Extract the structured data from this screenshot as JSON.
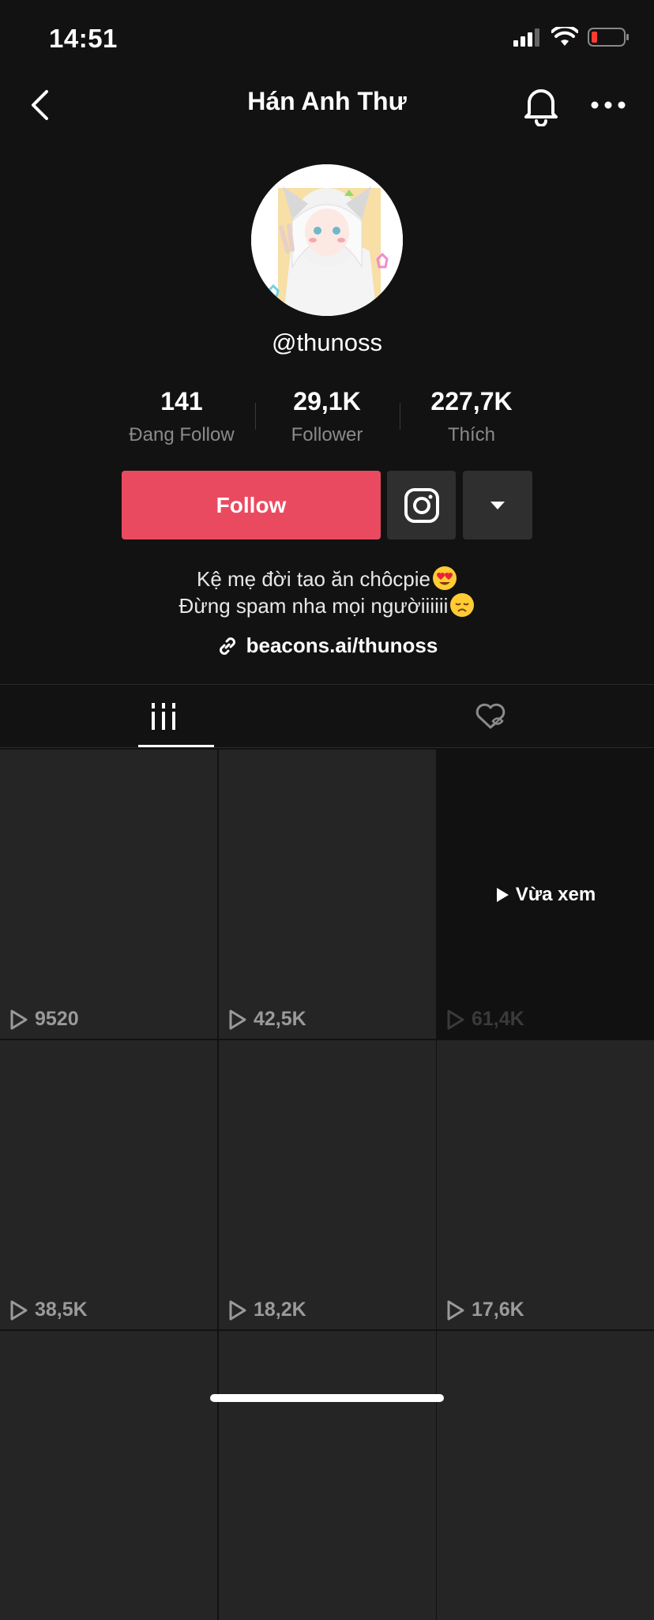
{
  "status_bar": {
    "time": "14:51"
  },
  "nav": {
    "title": "Hán Anh Thư"
  },
  "profile": {
    "username": "@thunoss",
    "stats": [
      {
        "value": "141",
        "label": "Đang Follow"
      },
      {
        "value": "29,1K",
        "label": "Follower"
      },
      {
        "value": "227,7K",
        "label": "Thích"
      }
    ],
    "follow_label": "Follow",
    "bio_line1": "Kệ mẹ đời tao ăn chôcpie",
    "bio_line2": "Đừng spam nha mọi ngườiiiiii",
    "link": "beacons.ai/thunoss"
  },
  "icons": {
    "back": "chevron-left-icon",
    "bell": "bell-icon",
    "more": "more-horizontal-icon",
    "instagram": "instagram-icon",
    "dropdown": "caret-down-icon",
    "link": "link-icon",
    "videos_tab": "grid-icon",
    "liked_tab": "liked-private-icon",
    "play": "play-icon"
  },
  "colors": {
    "accent": "#ea4a60",
    "background": "#121212",
    "tile": "#252525"
  },
  "videos": [
    {
      "views": "9520"
    },
    {
      "views": "42,5K"
    },
    {
      "views": "61,4K",
      "overlay": "Vừa xem"
    },
    {
      "views": "38,5K"
    },
    {
      "views": "18,2K"
    },
    {
      "views": "17,6K"
    }
  ]
}
